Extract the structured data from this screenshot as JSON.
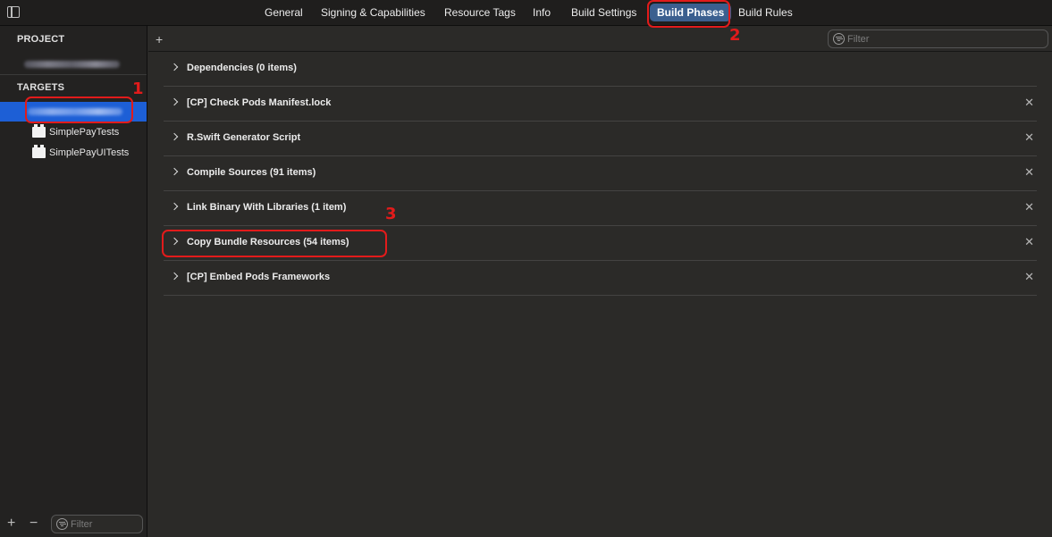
{
  "top_tabs": {
    "general": "General",
    "signing": "Signing & Capabilities",
    "resource_tags": "Resource Tags",
    "info": "Info",
    "build_settings": "Build Settings",
    "build_phases": "Build Phases",
    "build_rules": "Build Rules",
    "active": "Build Phases"
  },
  "sidebar": {
    "project_header": "PROJECT",
    "targets_header": "TARGETS",
    "targets": [
      {
        "label": "SimplePayTests"
      },
      {
        "label": "SimplePayUITests"
      }
    ],
    "filter_placeholder": "Filter"
  },
  "main": {
    "filter_placeholder": "Filter",
    "phases": [
      {
        "title": "Dependencies (0 items)",
        "removable": false
      },
      {
        "title": "[CP] Check Pods Manifest.lock",
        "removable": true
      },
      {
        "title": "R.Swift Generator Script",
        "removable": true
      },
      {
        "title": "Compile Sources (91 items)",
        "removable": true
      },
      {
        "title": "Link Binary With Libraries (1 item)",
        "removable": true
      },
      {
        "title": "Copy Bundle Resources (54 items)",
        "removable": true
      },
      {
        "title": "[CP] Embed Pods Frameworks",
        "removable": true
      }
    ]
  },
  "annotations": {
    "one": "1",
    "two": "2",
    "three": "3"
  },
  "icons": {
    "close": "✕",
    "plus": "+",
    "minus": "−"
  },
  "colors": {
    "accent": "#1d5fd6",
    "active_tab": "#3b5f8f",
    "annotation": "#e21b1b"
  }
}
